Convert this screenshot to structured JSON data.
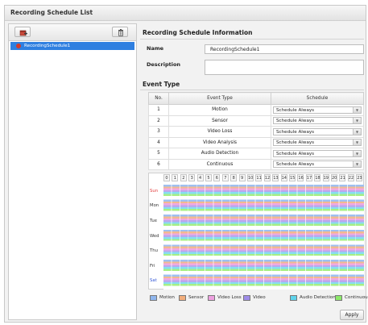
{
  "window": {
    "title": "Recording Schedule List"
  },
  "left_panel": {
    "add_icon": "calendar-add-icon",
    "delete_icon": "trash-icon",
    "schedules": [
      {
        "name": "RecordingSchedule1",
        "selected": true
      }
    ]
  },
  "info": {
    "title": "Recording Schedule Information",
    "name_label": "Name",
    "name_value": "RecordingSchedule1",
    "description_label": "Description",
    "description_value": ""
  },
  "event_type": {
    "title": "Event Type",
    "headers": {
      "no": "No.",
      "event": "Event Type",
      "schedule": "Schedule"
    },
    "rows": [
      {
        "no": "1",
        "event": "Motion",
        "schedule": "Schedule Always"
      },
      {
        "no": "2",
        "event": "Sensor",
        "schedule": "Schedule Always"
      },
      {
        "no": "3",
        "event": "Video Loss",
        "schedule": "Schedule Always"
      },
      {
        "no": "4",
        "event": "Video Analysis",
        "schedule": "Schedule Always"
      },
      {
        "no": "5",
        "event": "Audio Detection",
        "schedule": "Schedule Always"
      },
      {
        "no": "6",
        "event": "Continuous",
        "schedule": "Schedule Always"
      }
    ]
  },
  "grid": {
    "hours": [
      "0",
      "1",
      "2",
      "3",
      "4",
      "5",
      "6",
      "7",
      "8",
      "9",
      "10",
      "11",
      "12",
      "13",
      "14",
      "15",
      "16",
      "17",
      "18",
      "19",
      "20",
      "21",
      "22",
      "23"
    ],
    "days": [
      "Sun",
      "Mon",
      "Tue",
      "Wed",
      "Thu",
      "Fri",
      "Sat"
    ]
  },
  "legend": [
    {
      "label": "Motion",
      "color": "#8fb6ee"
    },
    {
      "label": "Sensor",
      "color": "#f2ae7c"
    },
    {
      "label": "Video Loss",
      "color": "#eea0e0"
    },
    {
      "label": "Video",
      "color": "#9e8ce8"
    },
    {
      "label": "Audio Detection",
      "color": "#5fd4ec"
    },
    {
      "label": "Continuous",
      "color": "#8ce86a"
    }
  ],
  "actions": {
    "apply": "Apply"
  }
}
